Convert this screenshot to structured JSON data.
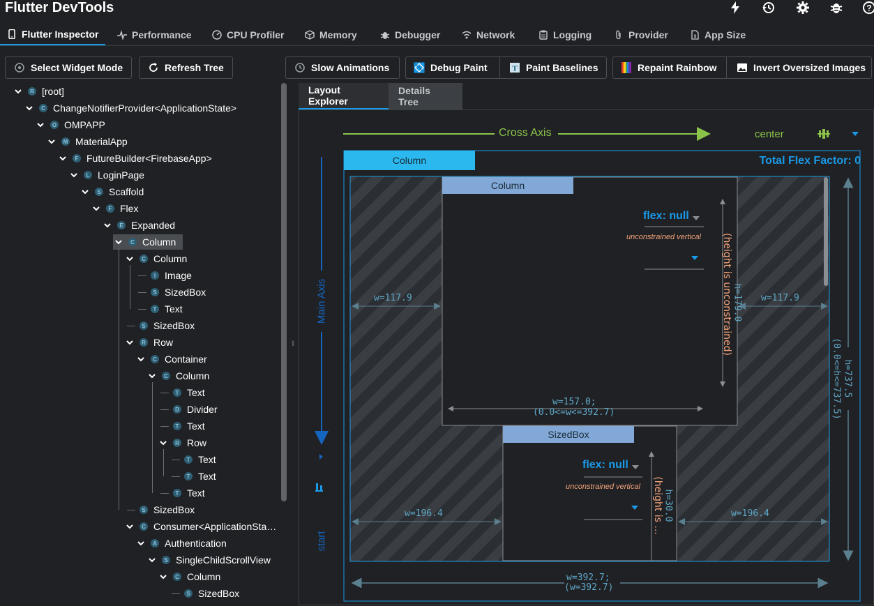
{
  "app": {
    "title": "Flutter DevTools"
  },
  "tabs": [
    {
      "label": "Flutter Inspector"
    },
    {
      "label": "Performance"
    },
    {
      "label": "CPU Profiler"
    },
    {
      "label": "Memory"
    },
    {
      "label": "Debugger"
    },
    {
      "label": "Network"
    },
    {
      "label": "Logging"
    },
    {
      "label": "Provider"
    },
    {
      "label": "App Size"
    }
  ],
  "toolbar": {
    "select_widget_mode": "Select Widget Mode",
    "refresh_tree": "Refresh Tree",
    "slow_animations": "Slow Animations",
    "debug_paint": "Debug Paint",
    "paint_baselines": "Paint Baselines",
    "repaint_rainbow": "Repaint Rainbow",
    "invert_oversized_images": "Invert Oversized Images"
  },
  "tree": [
    {
      "label": "[root]",
      "badge": "R"
    },
    {
      "label": "ChangeNotifierProvider<ApplicationState>",
      "badge": "C"
    },
    {
      "label": "OMPAPP",
      "badge": "O"
    },
    {
      "label": "MaterialApp",
      "badge": "M"
    },
    {
      "label": "FutureBuilder<FirebaseApp>",
      "badge": "F"
    },
    {
      "label": "LoginPage",
      "badge": "L"
    },
    {
      "label": "Scaffold",
      "badge": "S"
    },
    {
      "label": "Flex",
      "badge": "F"
    },
    {
      "label": "Expanded",
      "badge": "E"
    },
    {
      "label": "Column",
      "badge": "C"
    },
    {
      "label": "Column",
      "badge": "C"
    },
    {
      "label": "Image",
      "badge": "I"
    },
    {
      "label": "SizedBox",
      "badge": "S"
    },
    {
      "label": "Text",
      "badge": "T"
    },
    {
      "label": "SizedBox",
      "badge": "S"
    },
    {
      "label": "Row",
      "badge": "R"
    },
    {
      "label": "Container",
      "badge": "C"
    },
    {
      "label": "Column",
      "badge": "C"
    },
    {
      "label": "Text",
      "badge": "T"
    },
    {
      "label": "Divider",
      "badge": "D"
    },
    {
      "label": "Text",
      "badge": "T"
    },
    {
      "label": "Row",
      "badge": "R"
    },
    {
      "label": "Text",
      "badge": "T"
    },
    {
      "label": "Text",
      "badge": "T"
    },
    {
      "label": "Text",
      "badge": "T"
    },
    {
      "label": "SizedBox",
      "badge": "S"
    },
    {
      "label": "Consumer<ApplicationSta…",
      "badge": "C"
    },
    {
      "label": "Authentication",
      "badge": "A"
    },
    {
      "label": "SingleChildScrollView",
      "badge": "S"
    },
    {
      "label": "Column",
      "badge": "C"
    },
    {
      "label": "SizedBox",
      "badge": "S"
    }
  ],
  "layout_tabs": {
    "layout_explorer": "Layout Explorer",
    "details_tree": "Details Tree"
  },
  "layout": {
    "cross_axis": "Cross Axis",
    "main_axis": "Main Axis",
    "cross_alignment": "center",
    "main_alignment": "start",
    "total_flex": "Total Flex Factor: 0",
    "outer_label": "Column",
    "outer_w": "w=392.7;",
    "outer_w2": "(w=392.7)",
    "outer_h": "h=737.5",
    "outer_h2": "(0.0<=h<=737.5)",
    "child1": {
      "label": "Column",
      "flex": "flex: null",
      "unconstrained": "unconstrained vertical",
      "h": "h=179.0",
      "h_note": "(height is unconstrained)",
      "w": "w=157.0;",
      "w2": "(0.0<=w<=392.7)",
      "side_w": "w=117.9"
    },
    "child2": {
      "label": "SizedBox",
      "flex": "flex: null",
      "unconstrained": "unconstrained vertical",
      "h": "h=30.0",
      "h_note": "(height is ...",
      "side_w": "w=196.4"
    }
  }
}
